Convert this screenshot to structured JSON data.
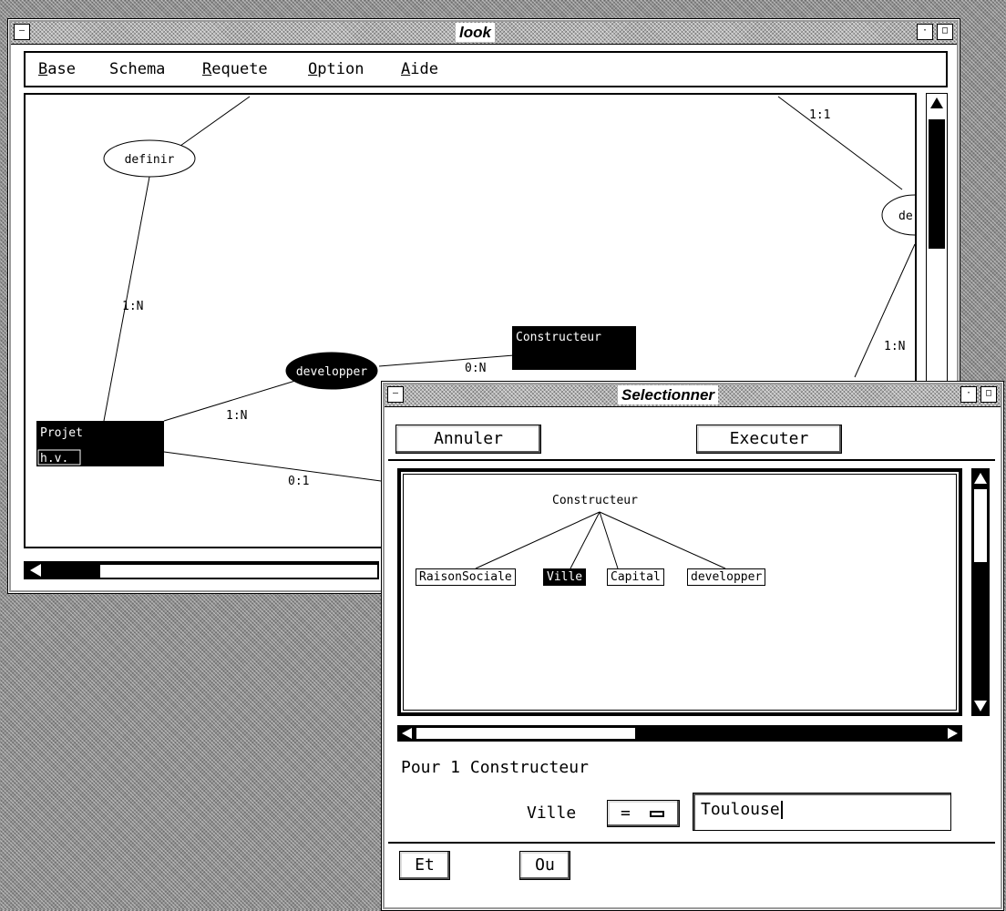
{
  "main_window": {
    "title": "look",
    "menu": {
      "base": {
        "u": "B",
        "rest": "ase"
      },
      "schema": {
        "text": "Schema"
      },
      "requete": {
        "u": "R",
        "rest": "equete"
      },
      "option": {
        "u": "O",
        "rest": "ption"
      },
      "aide": {
        "u": "A",
        "rest": "ide"
      }
    },
    "diagram": {
      "entities": {
        "projet": {
          "name": "Projet",
          "attribute": "h.v."
        },
        "constructeur": {
          "name": "Constructeur"
        }
      },
      "relationships": {
        "definir": "definir",
        "developper": "developper",
        "de_partial": "de"
      },
      "cardinalities": {
        "definir_projet": "1:N",
        "developper_projet": "1:N",
        "developper_constructeur": "0:N",
        "projet_other": "0:1",
        "top_right": "1:1",
        "right": "1:N"
      }
    }
  },
  "dialog": {
    "title": "Selectionner",
    "buttons": {
      "cancel": "Annuler",
      "execute": "Executer",
      "and": "Et",
      "or": "Ou"
    },
    "tree": {
      "root": "Constructeur",
      "children": [
        "RaisonSociale",
        "Ville",
        "Capital",
        "developper"
      ],
      "selected": "Ville"
    },
    "condition": {
      "header": "Pour 1 Constructeur",
      "attribute": "Ville",
      "operator": "=",
      "value": "Toulouse"
    }
  }
}
